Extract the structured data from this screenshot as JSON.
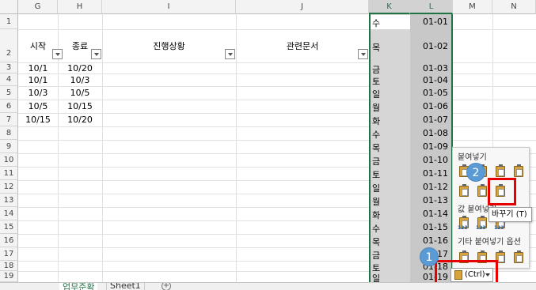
{
  "columns": [
    {
      "id": "G",
      "label": "G"
    },
    {
      "id": "H",
      "label": "H"
    },
    {
      "id": "I",
      "label": "I"
    },
    {
      "id": "J",
      "label": "J"
    },
    {
      "id": "K",
      "label": "K"
    },
    {
      "id": "L",
      "label": "L"
    },
    {
      "id": "M",
      "label": "M"
    },
    {
      "id": "N",
      "label": "N"
    }
  ],
  "rows": [
    "1",
    "2",
    "3",
    "4",
    "5",
    "6",
    "7",
    "8",
    "9",
    "10",
    "11",
    "12",
    "13",
    "14",
    "15",
    "16",
    "17",
    "18",
    "19"
  ],
  "headers": {
    "start": "시작",
    "end": "종료",
    "progress": "진행상황",
    "docs": "관련문서"
  },
  "schedule": [
    {
      "start": "10/1",
      "end": "10/20"
    },
    {
      "start": "10/1",
      "end": "10/3"
    },
    {
      "start": "10/3",
      "end": "10/5"
    },
    {
      "start": "10/5",
      "end": "10/15"
    },
    {
      "start": "10/15",
      "end": "10/20"
    }
  ],
  "weekdays": [
    "수",
    "목",
    "금",
    "토",
    "일",
    "월",
    "화",
    "수",
    "목",
    "금",
    "토",
    "일",
    "월",
    "화",
    "수",
    "목",
    "금",
    "토",
    "일"
  ],
  "dates": [
    "01-01",
    "01-02",
    "01-03",
    "01-04",
    "01-05",
    "01-06",
    "01-07",
    "01-08",
    "01-09",
    "01-10",
    "01-11",
    "01-12",
    "01-13",
    "01-14",
    "01-15",
    "01-16",
    "01-17",
    "01-18",
    "01-19"
  ],
  "paste_menu": {
    "title_paste": "붙여넣기",
    "title_values": "값 붙여넣기",
    "title_other": "기타 붙여넣기 옵션",
    "tooltip": "바꾸기 (T)",
    "ctrl_label": "(Ctrl)"
  },
  "badges": {
    "one": "1",
    "two": "2"
  },
  "sheet_tabs": {
    "active": "업무준확",
    "other": "Sheet1",
    "add": "+"
  },
  "colors": {
    "accent": "#217346",
    "highlight": "#e60000",
    "badge": "#5b9bd5"
  }
}
